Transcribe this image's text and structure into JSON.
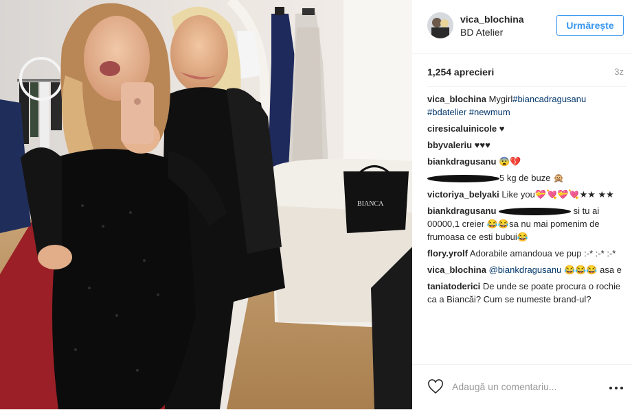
{
  "post": {
    "username": "vica_blochina",
    "location": "BD Atelier",
    "follow_label": "Urmărește",
    "likes": "1,254 aprecieri",
    "time": "3z",
    "comment_placeholder": "Adaugă un comentariu...",
    "icons": {
      "like": "heart-icon",
      "more": "more-options-icon"
    }
  },
  "caption": {
    "user": "vica_blochina",
    "text_1": " Mygirl",
    "tag_1": "#biancadragusanu",
    "tag_2": "#bdatelier",
    "tag_3": "#newmum"
  },
  "comments": [
    {
      "user": "ciresicaluinicole",
      "text": " ♥"
    },
    {
      "user": "bbyvaleriu",
      "text": " ♥♥♥"
    },
    {
      "user": "biankdragusanu",
      "text": " 😨💔"
    },
    {
      "user": "",
      "text": "5 kg de buze 🙊"
    },
    {
      "user": "victoriya_belyaki",
      "text": " Like you💝💘💝💘★★ ★★"
    },
    {
      "user": "biankdragusanu",
      "text_after": " si tu ai 00000,1 creier 😂😂sa nu mai pomenim de frumoasa ce esti bubui😂"
    },
    {
      "user": "flory.yrolf",
      "text": " Adorabile amandoua ve pup :-* :-* :-*"
    },
    {
      "user": "vica_blochina",
      "mention": "@biankdragusanu",
      "text": " 😂😂😂 asa e"
    },
    {
      "user": "taniatoderici",
      "text": " De unde se poate procura o rochie ca a Biancăi? Cum se numeste brand-ul?"
    }
  ],
  "colors": {
    "link": "#003569",
    "follow": "#3897f0",
    "muted": "#999999"
  }
}
